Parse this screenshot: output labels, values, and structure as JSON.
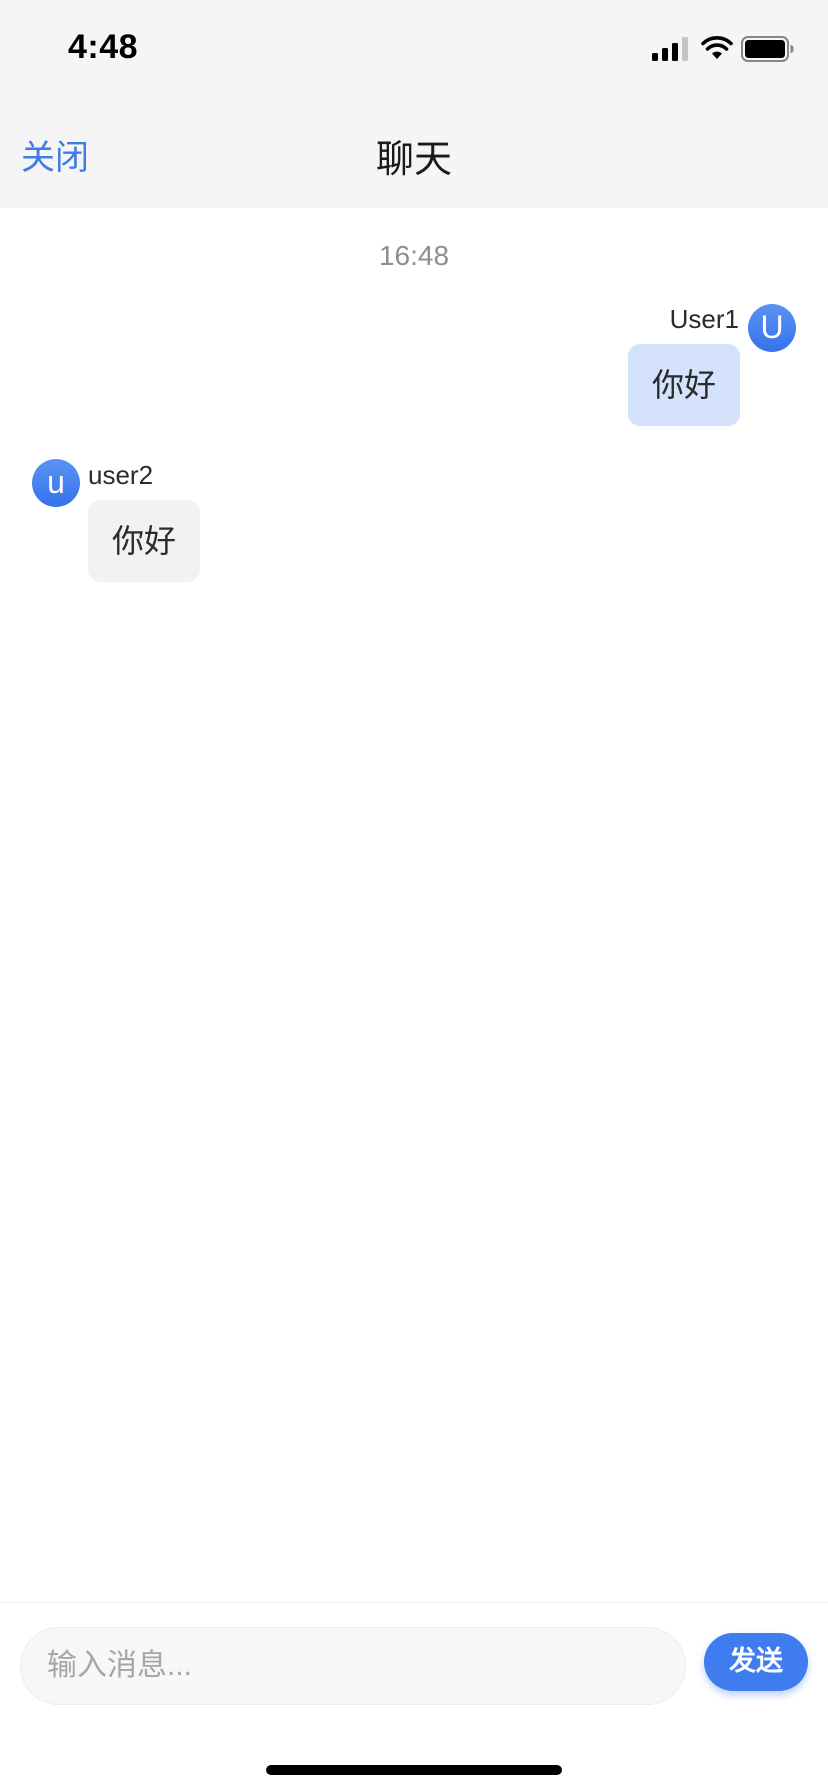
{
  "status_bar": {
    "time": "4:48",
    "icons": [
      "signal-icon",
      "wifi-icon",
      "battery-icon"
    ]
  },
  "nav": {
    "close_label": "关闭",
    "title": "聊天"
  },
  "chat": {
    "timestamp": "16:48",
    "messages": [
      {
        "sender": "User1",
        "avatar_letter": "U",
        "text": "你好",
        "direction": "outgoing"
      },
      {
        "sender": "user2",
        "avatar_letter": "u",
        "text": "你好",
        "direction": "incoming"
      }
    ]
  },
  "input": {
    "placeholder": "输入消息...",
    "value": "",
    "send_label": "发送"
  },
  "colors": {
    "accent": "#3e7cf0",
    "outgoing_bubble": "#d4e3fb",
    "incoming_bubble": "#f1f2f4",
    "bar_background": "#f5f5f5"
  }
}
